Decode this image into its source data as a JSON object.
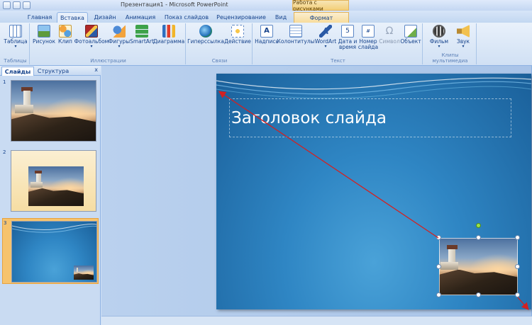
{
  "window": {
    "title": "Презентация1 - Microsoft PowerPoint",
    "context_tab_group": "Работа с рисунками"
  },
  "tabs": [
    {
      "label": "Главная"
    },
    {
      "label": "Вставка"
    },
    {
      "label": "Дизайн"
    },
    {
      "label": "Анимация"
    },
    {
      "label": "Показ слайдов"
    },
    {
      "label": "Рецензирование"
    },
    {
      "label": "Вид"
    },
    {
      "label": "Формат"
    }
  ],
  "ribbon": {
    "groups": [
      {
        "label": "Таблицы",
        "buttons": [
          {
            "label": "Таблица",
            "icon": "table-icon"
          }
        ]
      },
      {
        "label": "Иллюстрации",
        "buttons": [
          {
            "label": "Рисунок",
            "icon": "picture-icon"
          },
          {
            "label": "Клип",
            "icon": "clip-icon"
          },
          {
            "label": "Фотоальбом",
            "icon": "photo-album-icon"
          },
          {
            "label": "Фигуры",
            "icon": "shapes-icon"
          },
          {
            "label": "SmartArt",
            "icon": "smartart-icon"
          },
          {
            "label": "Диаграмма",
            "icon": "chart-icon"
          }
        ]
      },
      {
        "label": "Связи",
        "buttons": [
          {
            "label": "Гиперссылка",
            "icon": "hyperlink-icon"
          },
          {
            "label": "Действие",
            "icon": "action-icon"
          }
        ]
      },
      {
        "label": "Текст",
        "buttons": [
          {
            "label": "Надпись",
            "icon": "textbox-icon"
          },
          {
            "label": "Колонтитулы",
            "icon": "header-footer-icon"
          },
          {
            "label": "WordArt",
            "icon": "wordart-icon"
          },
          {
            "label": "Дата и время",
            "icon": "date-time-icon"
          },
          {
            "label": "Номер слайда",
            "icon": "slide-number-icon"
          },
          {
            "label": "Символ",
            "icon": "symbol-icon"
          },
          {
            "label": "Объект",
            "icon": "object-icon"
          }
        ]
      },
      {
        "label": "Клипы мультимедиа",
        "buttons": [
          {
            "label": "Фильм",
            "icon": "movie-icon"
          },
          {
            "label": "Звук",
            "icon": "sound-icon"
          }
        ]
      }
    ],
    "date_label_line1": "Дата и",
    "date_label_line2": "время",
    "num_label_line1": "Номер",
    "num_label_line2": "слайда"
  },
  "side_panel": {
    "tabs": [
      "Слайды",
      "Структура"
    ],
    "close_label": "x",
    "slides": [
      {
        "number": "1"
      },
      {
        "number": "2"
      },
      {
        "number": "3"
      }
    ]
  },
  "slide": {
    "title_placeholder": "Заголовок слайда"
  },
  "colors": {
    "accent": "#15428b",
    "arrow": "#d42020",
    "selected_slide": "#f6c36d"
  }
}
